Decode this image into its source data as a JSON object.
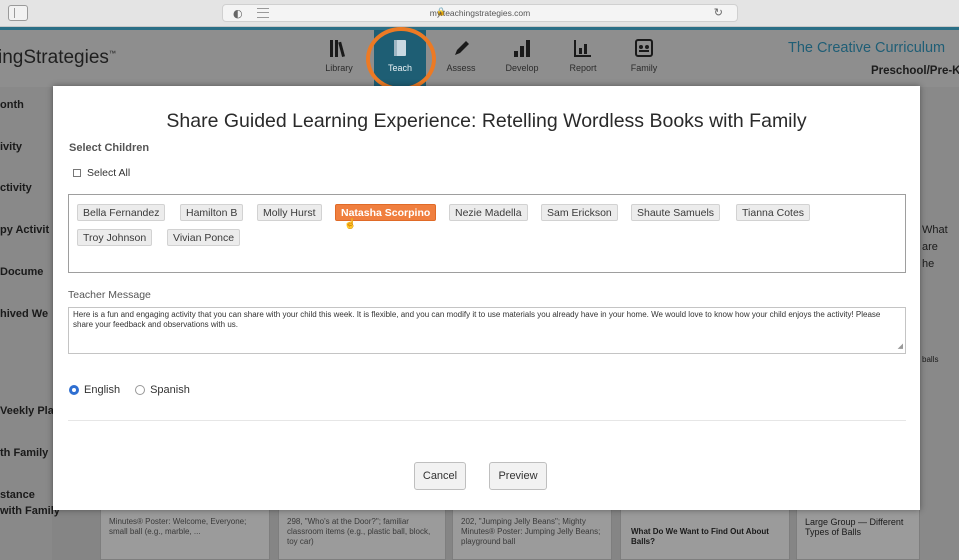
{
  "browser": {
    "url": "my.teachingstrategies.com"
  },
  "app": {
    "brand_partial": "ingStrategies",
    "brand_tm": "™",
    "nav": [
      {
        "label": "Library",
        "icon": "library-icon"
      },
      {
        "label": "Teach",
        "icon": "book-icon",
        "active": true
      },
      {
        "label": "Assess",
        "icon": "pencil-icon"
      },
      {
        "label": "Develop",
        "icon": "bar-chart-icon"
      },
      {
        "label": "Report",
        "icon": "report-icon"
      },
      {
        "label": "Family",
        "icon": "family-icon"
      }
    ],
    "curriculum_title": "The Creative Curriculum",
    "curriculum_sub": "Preschool/Pre-K"
  },
  "background": {
    "left_items": [
      "onth",
      "ivity",
      "ctivity",
      "py Activit",
      "Docume",
      "hived We",
      "Veekly Pla",
      "th Family",
      "stance",
      " with Family"
    ],
    "right_texts": [
      "What",
      "are",
      "he",
      "balls"
    ],
    "cards": [
      {
        "text": "Minutes® Poster: Welcome, Everyone; small ball (e.g., marble, ..."
      },
      {
        "text": "298, \"Who's at the Door?\"; familiar classroom items (e.g., plastic ball, block, toy car)"
      },
      {
        "text": "202, \"Jumping Jelly Beans\"; Mighty Minutes® Poster: Jumping Jelly Beans; playground ball"
      },
      {
        "text": "What Do We Want to Find Out About Balls?"
      },
      {
        "text": "Large Group — Different Types of Balls"
      }
    ]
  },
  "modal": {
    "title": "Share Guided Learning Experience: Retelling Wordless Books with Family",
    "select_children_label": "Select Children",
    "select_all_label": "Select All",
    "children": [
      {
        "name": "Bella Fernandez",
        "selected": false
      },
      {
        "name": "Hamilton B",
        "selected": false
      },
      {
        "name": "Molly Hurst",
        "selected": false
      },
      {
        "name": "Natasha Scorpino",
        "selected": true
      },
      {
        "name": "Nezie Madella",
        "selected": false
      },
      {
        "name": "Sam Erickson",
        "selected": false
      },
      {
        "name": "Shaute Samuels",
        "selected": false
      },
      {
        "name": "Tianna Cotes",
        "selected": false
      },
      {
        "name": "Troy Johnson",
        "selected": false
      },
      {
        "name": "Vivian Ponce",
        "selected": false
      }
    ],
    "teacher_message_label": "Teacher Message",
    "teacher_message": "Here is a fun and engaging activity that you can share with your child this week. It is flexible, and you can modify it to use materials you already have in your home. We would love to know how your child enjoys the activity! Please share your feedback and observations with us.",
    "languages": [
      {
        "label": "English",
        "selected": true
      },
      {
        "label": "Spanish",
        "selected": false
      }
    ],
    "cancel_label": "Cancel",
    "preview_label": "Preview"
  },
  "colors": {
    "accent_orange": "#f07f3f",
    "teach_ring": "#ec7a24",
    "brand_teal": "#1e5e74",
    "radio_blue": "#2f6fd1"
  }
}
